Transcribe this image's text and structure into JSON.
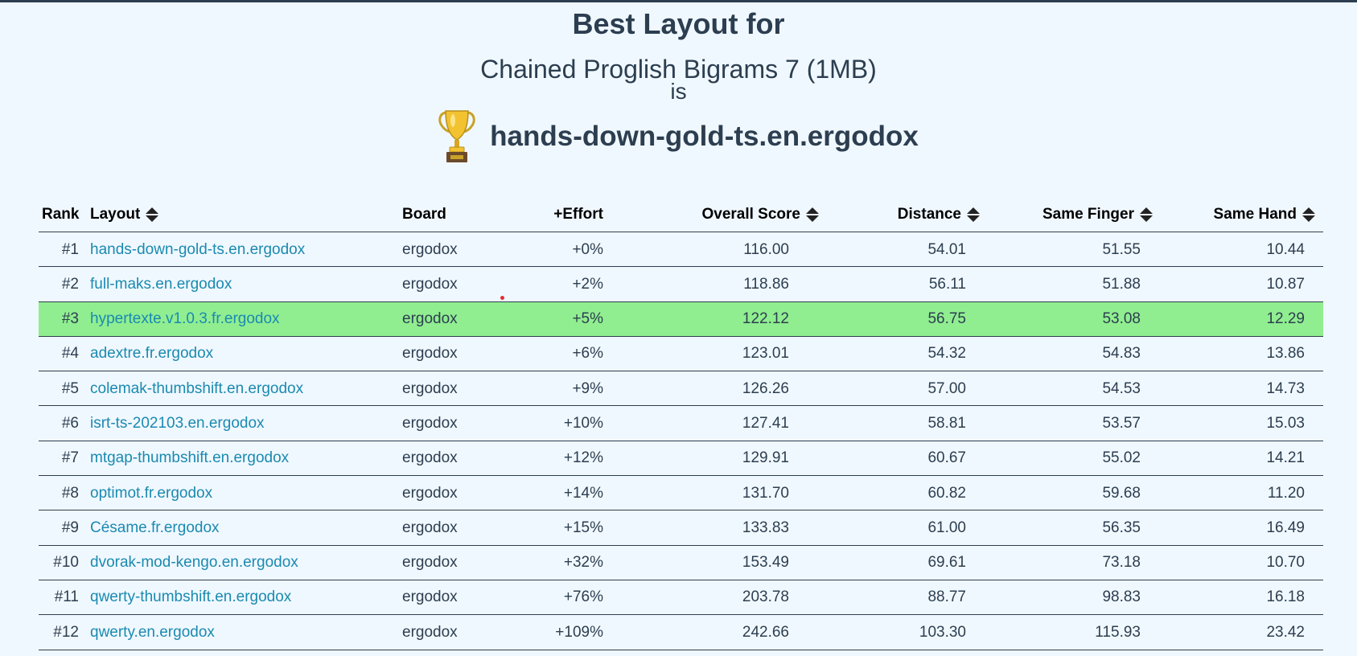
{
  "heading": {
    "best_layout_for": "Best Layout for",
    "corpus": "Chained Proglish Bigrams 7 (1MB)",
    "is": "is",
    "winner": "hands-down-gold-ts.en.ergodox",
    "trophy_icon": "trophy-icon"
  },
  "table": {
    "columns": {
      "rank": "Rank",
      "layout": "Layout",
      "board": "Board",
      "effort": "+Effort",
      "overall": "Overall Score",
      "distance": "Distance",
      "same_finger": "Same Finger",
      "same_hand": "Same Hand"
    },
    "highlight_color": "#90ee90",
    "link_color": "#1a8ab0",
    "rows": [
      {
        "rank": "#1",
        "layout": "hands-down-gold-ts.en.ergodox",
        "board": "ergodox",
        "effort": "+0%",
        "overall": "116.00",
        "distance": "54.01",
        "same_finger": "51.55",
        "same_hand": "10.44"
      },
      {
        "rank": "#2",
        "layout": "full-maks.en.ergodox",
        "board": "ergodox",
        "effort": "+2%",
        "overall": "118.86",
        "distance": "56.11",
        "same_finger": "51.88",
        "same_hand": "10.87"
      },
      {
        "rank": "#3",
        "layout": "hypertexte.v1.0.3.fr.ergodox",
        "board": "ergodox",
        "effort": "+5%",
        "overall": "122.12",
        "distance": "56.75",
        "same_finger": "53.08",
        "same_hand": "12.29",
        "highlighted": true
      },
      {
        "rank": "#4",
        "layout": "adextre.fr.ergodox",
        "board": "ergodox",
        "effort": "+6%",
        "overall": "123.01",
        "distance": "54.32",
        "same_finger": "54.83",
        "same_hand": "13.86"
      },
      {
        "rank": "#5",
        "layout": "colemak-thumbshift.en.ergodox",
        "board": "ergodox",
        "effort": "+9%",
        "overall": "126.26",
        "distance": "57.00",
        "same_finger": "54.53",
        "same_hand": "14.73"
      },
      {
        "rank": "#6",
        "layout": "isrt-ts-202103.en.ergodox",
        "board": "ergodox",
        "effort": "+10%",
        "overall": "127.41",
        "distance": "58.81",
        "same_finger": "53.57",
        "same_hand": "15.03"
      },
      {
        "rank": "#7",
        "layout": "mtgap-thumbshift.en.ergodox",
        "board": "ergodox",
        "effort": "+12%",
        "overall": "129.91",
        "distance": "60.67",
        "same_finger": "55.02",
        "same_hand": "14.21"
      },
      {
        "rank": "#8",
        "layout": "optimot.fr.ergodox",
        "board": "ergodox",
        "effort": "+14%",
        "overall": "131.70",
        "distance": "60.82",
        "same_finger": "59.68",
        "same_hand": "11.20"
      },
      {
        "rank": "#9",
        "layout": "Césame.fr.ergodox",
        "board": "ergodox",
        "effort": "+15%",
        "overall": "133.83",
        "distance": "61.00",
        "same_finger": "56.35",
        "same_hand": "16.49"
      },
      {
        "rank": "#10",
        "layout": "dvorak-mod-kengo.en.ergodox",
        "board": "ergodox",
        "effort": "+32%",
        "overall": "153.49",
        "distance": "69.61",
        "same_finger": "73.18",
        "same_hand": "10.70"
      },
      {
        "rank": "#11",
        "layout": "qwerty-thumbshift.en.ergodox",
        "board": "ergodox",
        "effort": "+76%",
        "overall": "203.78",
        "distance": "88.77",
        "same_finger": "98.83",
        "same_hand": "16.18"
      },
      {
        "rank": "#12",
        "layout": "qwerty.en.ergodox",
        "board": "ergodox",
        "effort": "+109%",
        "overall": "242.66",
        "distance": "103.30",
        "same_finger": "115.93",
        "same_hand": "23.42"
      }
    ]
  }
}
